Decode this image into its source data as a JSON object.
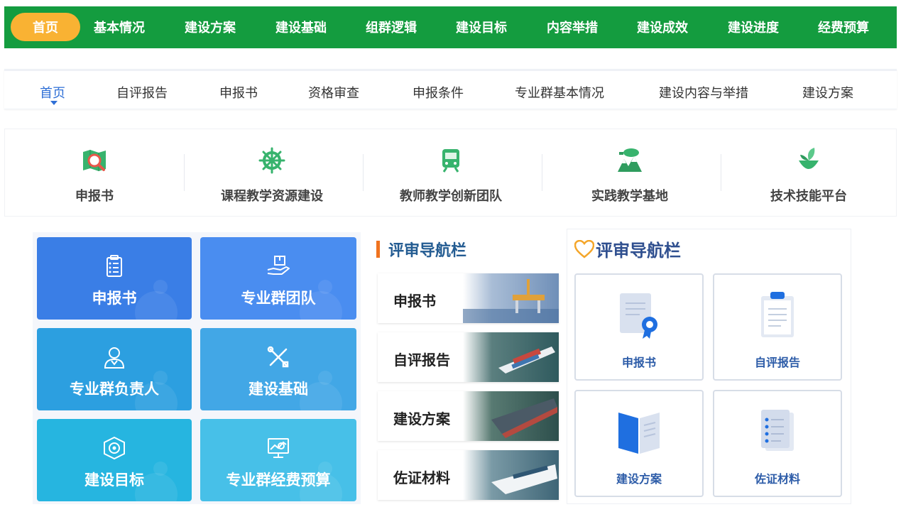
{
  "topnav": {
    "items": [
      "首页",
      "基本情况",
      "建设方案",
      "建设基础",
      "组群逻辑",
      "建设目标",
      "内容举措",
      "建设成效",
      "建设进度",
      "经费预算"
    ]
  },
  "subnav": {
    "items": [
      "首页",
      "自评报告",
      "申报书",
      "资格审查",
      "申报条件",
      "专业群基本情况",
      "建设内容与举措",
      "建设方案"
    ]
  },
  "iconrow": {
    "items": [
      {
        "label": "申报书",
        "icon": "map-search-icon"
      },
      {
        "label": "课程教学资源建设",
        "icon": "ship-wheel-icon"
      },
      {
        "label": "教师教学创新团队",
        "icon": "train-icon"
      },
      {
        "label": "实践教学基地",
        "icon": "landscape-icon"
      },
      {
        "label": "技术技能平台",
        "icon": "leaf-bowl-icon"
      }
    ]
  },
  "tiles": [
    {
      "label": "申报书",
      "icon": "clipboard-list-icon",
      "color": "#3a7ee6"
    },
    {
      "label": "专业群团队",
      "icon": "hand-box-icon",
      "color": "#4a8df0"
    },
    {
      "label": "专业群负责人",
      "icon": "user-icon",
      "color": "#2c9fe0"
    },
    {
      "label": "建设基础",
      "icon": "tools-icon",
      "color": "#42a7e6"
    },
    {
      "label": "建设目标",
      "icon": "target-cube-icon",
      "color": "#26b5e0"
    },
    {
      "label": "专业群经费预算",
      "icon": "monitor-chart-icon",
      "color": "#47c0e8"
    }
  ],
  "midpanel": {
    "title": "评审导航栏",
    "rows": [
      "申报书",
      "自评报告",
      "建设方案",
      "佐证材料"
    ]
  },
  "rightpanel": {
    "title": "评审导航栏",
    "cards": [
      "申报书",
      "自评报告",
      "建设方案",
      "佐证材料"
    ]
  },
  "colors": {
    "topnav_bg": "#149c3f",
    "topnav_active": "#f9b233",
    "subnav_active": "#2f6fd6",
    "accent_orange": "#f0731f"
  }
}
